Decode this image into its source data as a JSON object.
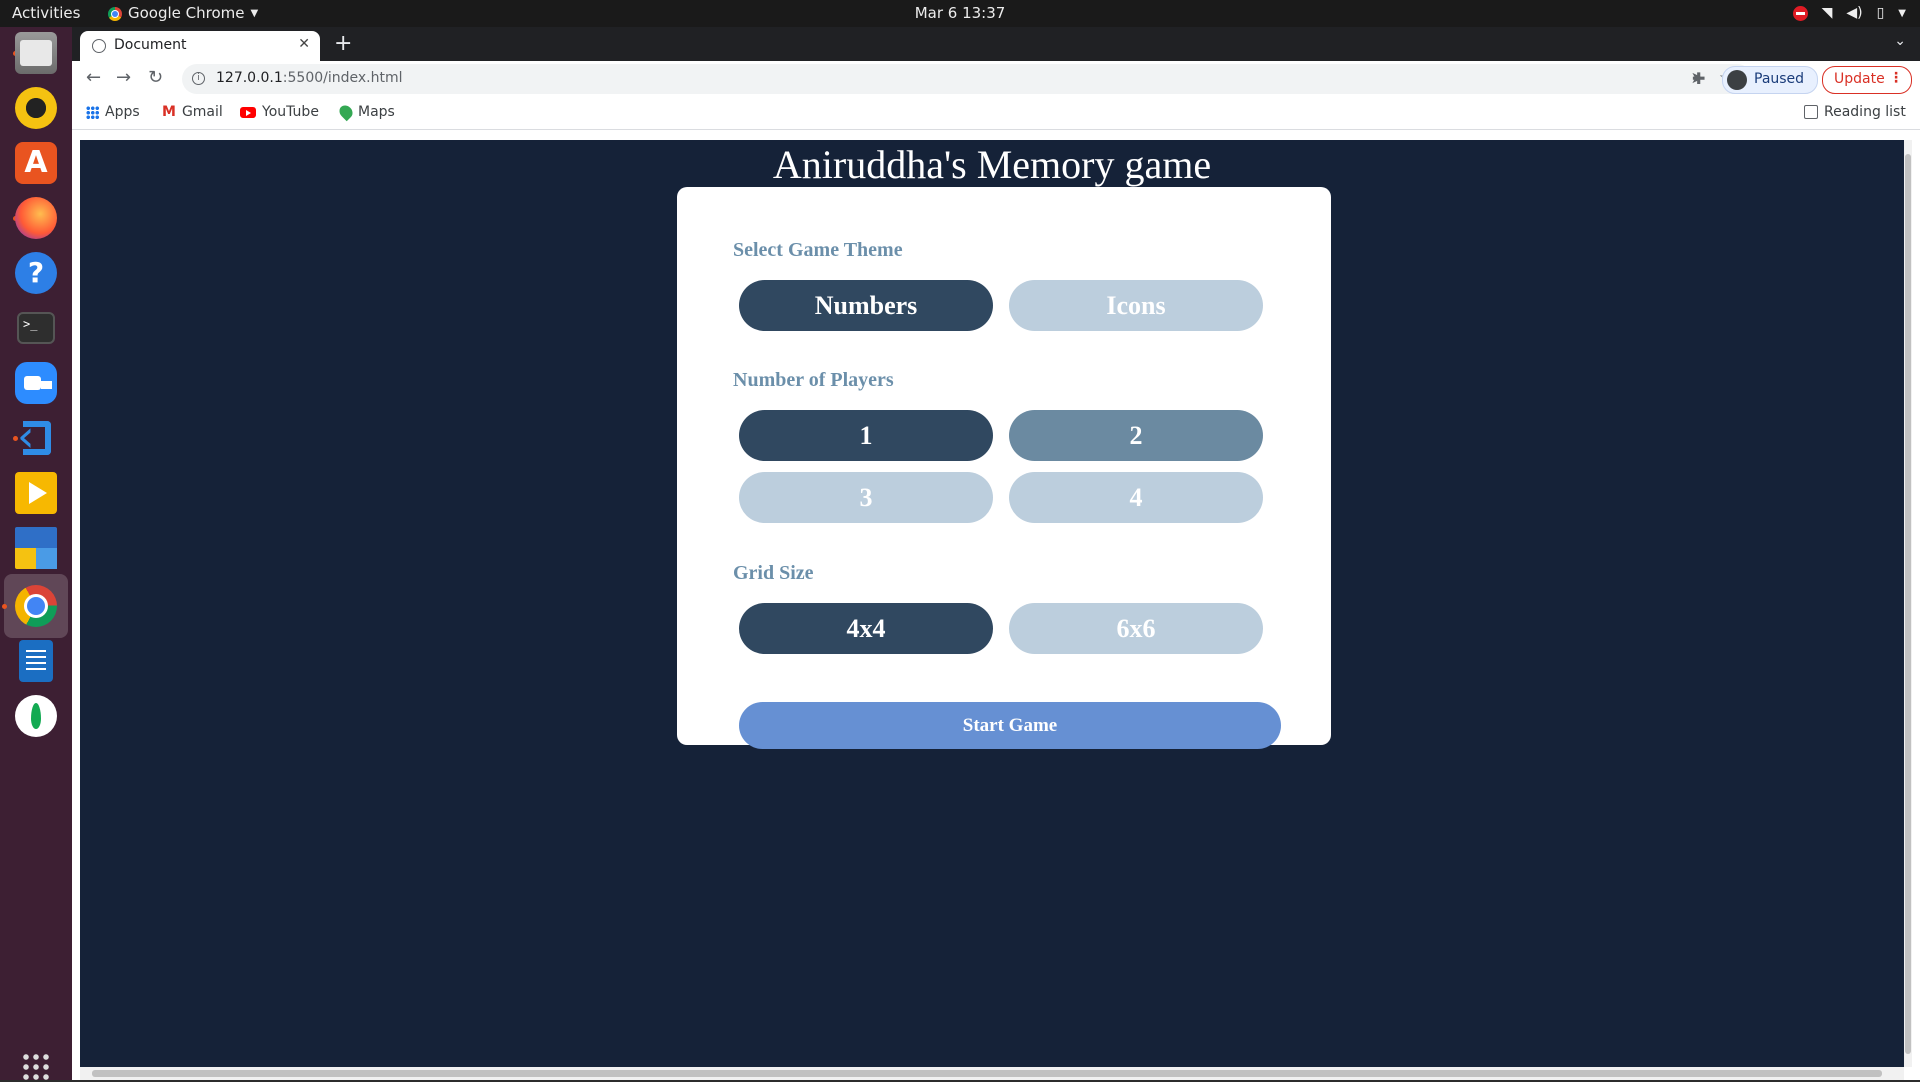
{
  "system_bar": {
    "activities": "Activities",
    "app_name": "Google Chrome",
    "clock": "Mar 6  13:37"
  },
  "dock": {
    "apps": [
      "files",
      "rhythmbox",
      "ubuntu-software",
      "firefox",
      "help",
      "terminal",
      "zoom",
      "vscode",
      "slides",
      "blocks",
      "chrome",
      "writer",
      "mongodb-compass"
    ],
    "active_app": "chrome",
    "icon_show_apps": "grid-icon"
  },
  "browser": {
    "tab_title": "Document",
    "url_host": "127.0.0.1",
    "url_rest": ":5500/index.html",
    "profile_label": "Paused",
    "update_label": "Update",
    "bookmarks": [
      "Apps",
      "Gmail",
      "YouTube",
      "Maps"
    ],
    "reading_list": "Reading list"
  },
  "game": {
    "title": "Aniruddha's Memory game",
    "theme": {
      "label": "Select Game Theme",
      "options": [
        "Numbers",
        "Icons"
      ],
      "selected": "Numbers"
    },
    "players": {
      "label": "Number of Players",
      "options": [
        "1",
        "2",
        "3",
        "4"
      ],
      "selected": "1"
    },
    "grid": {
      "label": "Grid Size",
      "options": [
        "4x4",
        "6x6"
      ],
      "selected": "4x4"
    },
    "start_label": "Start Game"
  },
  "colors": {
    "page_background": "#152238",
    "selected_button": "#304860",
    "hover_button": "#6b8aa1",
    "idle_button": "#bccedd",
    "start_button": "#6690d3",
    "section_label": "#6b8faa"
  }
}
